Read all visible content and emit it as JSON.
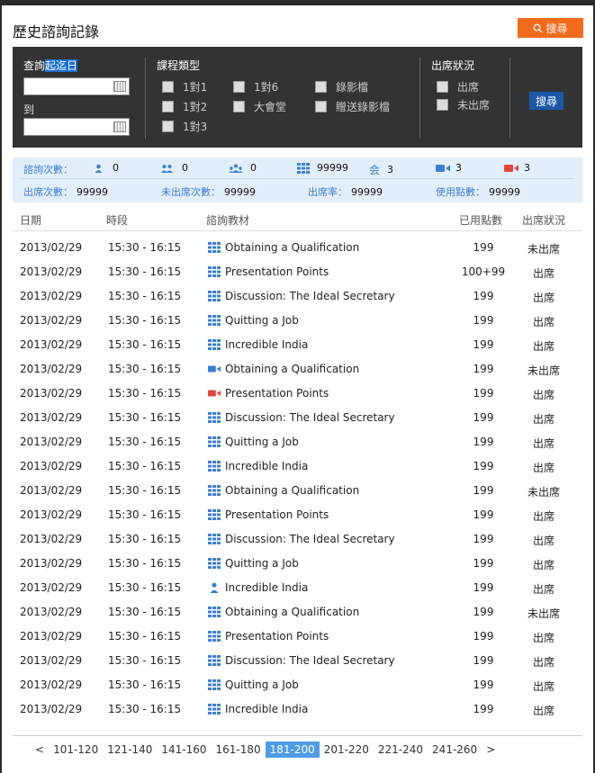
{
  "header": {
    "title": "歷史諮詢記錄",
    "search_label": "搜尋"
  },
  "filter": {
    "date_heading_pre": "查詢",
    "date_heading_hl": "起迄日",
    "to_label": "到",
    "course_heading": "課程類型",
    "course_types": [
      "1對1",
      "1對6",
      "錄影檔",
      "1對2",
      "大會堂",
      "贈送錄影檔",
      "1對3"
    ],
    "attendance_heading": "出席狀況",
    "attendance": [
      "出席",
      "未出席"
    ],
    "search_label": "搜尋"
  },
  "stats": {
    "count_label": "諮詢次數：",
    "c_person": "0",
    "c_pair": "0",
    "c_group": "0",
    "c_grid": "99999",
    "c_hall_label": "会",
    "c_hall": "3",
    "c_video": "3",
    "c_redvideo": "3",
    "attend_label": "出席次數：",
    "attend": "99999",
    "absent_label": "未出席次數：",
    "absent": "99999",
    "rate_label": "出席率：",
    "rate": "99999",
    "points_label": "使用點數：",
    "points": "99999",
    "colors": {
      "blue": "#3a7fd5",
      "red": "#e5443a"
    }
  },
  "table": {
    "headers": [
      "日期",
      "時段",
      "諮詢教材",
      "已用點數",
      "出席狀況"
    ],
    "rows": [
      {
        "date": "2013/02/29",
        "time": "15:30 - 16:15",
        "icon": "grid-icon",
        "material": "Obtaining a Qualification",
        "points": "199",
        "status": "未出席"
      },
      {
        "date": "2013/02/29",
        "time": "15:30 - 16:15",
        "icon": "grid-icon",
        "material": "Presentation Points",
        "points": "100+99",
        "status": "出席"
      },
      {
        "date": "2013/02/29",
        "time": "15:30 - 16:15",
        "icon": "grid-icon",
        "material": "Discussion: The Ideal Secretary",
        "points": "199",
        "status": "出席"
      },
      {
        "date": "2013/02/29",
        "time": "15:30 - 16:15",
        "icon": "grid-icon",
        "material": "Quitting a Job",
        "points": "199",
        "status": "出席"
      },
      {
        "date": "2013/02/29",
        "time": "15:30 - 16:15",
        "icon": "grid-icon",
        "material": "Incredible India",
        "points": "199",
        "status": "出席"
      },
      {
        "date": "2013/02/29",
        "time": "15:30 - 16:15",
        "icon": "video-icon",
        "material": "Obtaining a Qualification",
        "points": "199",
        "status": "未出席"
      },
      {
        "date": "2013/02/29",
        "time": "15:30 - 16:15",
        "icon": "red-video-icon",
        "material": "Presentation Points",
        "points": "199",
        "status": "出席"
      },
      {
        "date": "2013/02/29",
        "time": "15:30 - 16:15",
        "icon": "grid-icon",
        "material": "Discussion: The Ideal Secretary",
        "points": "199",
        "status": "出席"
      },
      {
        "date": "2013/02/29",
        "time": "15:30 - 16:15",
        "icon": "grid-icon",
        "material": "Quitting a Job",
        "points": "199",
        "status": "出席"
      },
      {
        "date": "2013/02/29",
        "time": "15:30 - 16:15",
        "icon": "grid-icon",
        "material": "Incredible India",
        "points": "199",
        "status": "出席"
      },
      {
        "date": "2013/02/29",
        "time": "15:30 - 16:15",
        "icon": "grid-icon",
        "material": "Obtaining a Qualification",
        "points": "199",
        "status": "未出席"
      },
      {
        "date": "2013/02/29",
        "time": "15:30 - 16:15",
        "icon": "grid-icon",
        "material": "Presentation Points",
        "points": "199",
        "status": "出席"
      },
      {
        "date": "2013/02/29",
        "time": "15:30 - 16:15",
        "icon": "grid-icon",
        "material": "Discussion: The Ideal Secretary",
        "points": "199",
        "status": "出席"
      },
      {
        "date": "2013/02/29",
        "time": "15:30 - 16:15",
        "icon": "grid-icon",
        "material": "Quitting a Job",
        "points": "199",
        "status": "出席"
      },
      {
        "date": "2013/02/29",
        "time": "15:30 - 16:15",
        "icon": "person-icon",
        "material": "Incredible India",
        "points": "199",
        "status": "出席"
      },
      {
        "date": "2013/02/29",
        "time": "15:30 - 16:15",
        "icon": "grid-icon",
        "material": "Obtaining a Qualification",
        "points": "199",
        "status": "未出席"
      },
      {
        "date": "2013/02/29",
        "time": "15:30 - 16:15",
        "icon": "grid-icon",
        "material": "Presentation Points",
        "points": "199",
        "status": "出席"
      },
      {
        "date": "2013/02/29",
        "time": "15:30 - 16:15",
        "icon": "grid-icon",
        "material": "Discussion: The Ideal Secretary",
        "points": "199",
        "status": "出席"
      },
      {
        "date": "2013/02/29",
        "time": "15:30 - 16:15",
        "icon": "grid-icon",
        "material": "Quitting a Job",
        "points": "199",
        "status": "出席"
      },
      {
        "date": "2013/02/29",
        "time": "15:30 - 16:15",
        "icon": "grid-icon",
        "material": "Incredible India",
        "points": "199",
        "status": "出席"
      }
    ]
  },
  "pager": {
    "prev": "<",
    "pages": [
      "101-120",
      "121-140",
      "141-160",
      "161-180",
      "181-200",
      "201-220",
      "221-240",
      "241-260"
    ],
    "active": "181-200",
    "next": ">"
  }
}
